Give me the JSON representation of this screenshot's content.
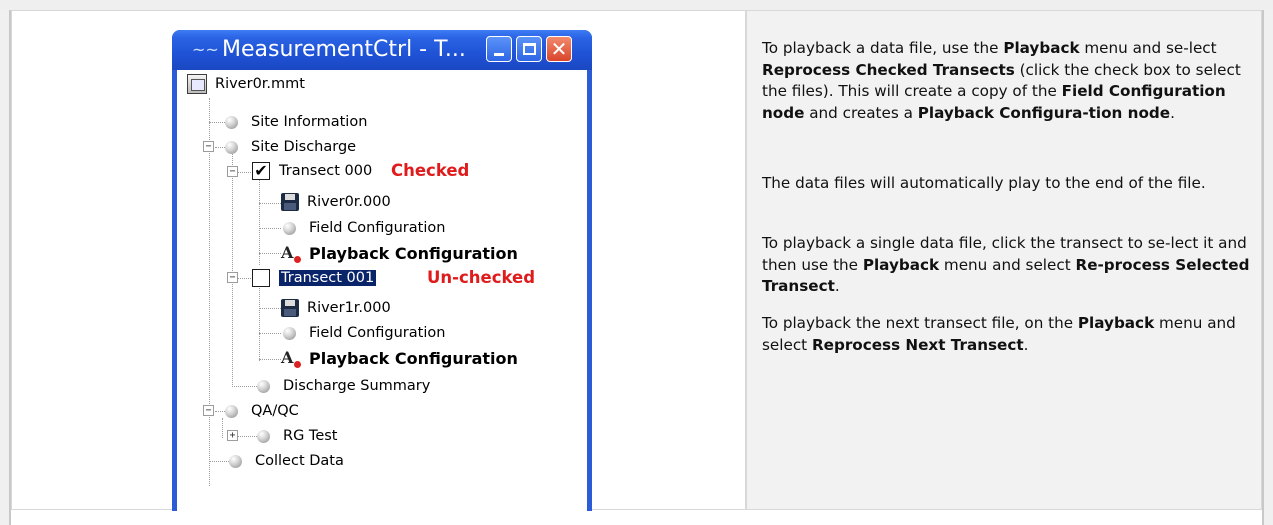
{
  "window": {
    "title": "MeasurementCtrl - T...",
    "title_icon": "measurement-app-icon"
  },
  "tree": {
    "root": "River0r.mmt",
    "site_information": "Site Information",
    "site_discharge": "Site Discharge",
    "transect0": {
      "label": "Transect 000",
      "checked": true,
      "annotation": "Checked",
      "file": "River0r.000",
      "field_config": "Field Configuration",
      "playback_config": "Playback Configuration"
    },
    "transect1": {
      "label": "Transect 001",
      "checked": false,
      "annotation": "Un-checked",
      "file": "River1r.000",
      "field_config": "Field Configuration",
      "playback_config": "Playback Configuration"
    },
    "discharge_summary": "Discharge Summary",
    "qaqc": "QA/QC",
    "rg_test": "RG Test",
    "collect_data": "Collect Data"
  },
  "colors": {
    "annotation": "#e01b1b",
    "selection": "#0a246a",
    "titlebar": "#2a63e4"
  },
  "instructions": {
    "p1": {
      "t1": "To playback a data file, use the ",
      "b1": "Playback",
      "t2": " menu and se-lect ",
      "b2": "Reprocess Checked Transects",
      "t3": " (click the check box to select the files). This will create a copy of the ",
      "b3": "Field Configuration node",
      "t4": " and creates a ",
      "b4": "Playback Configura-tion node",
      "t5": "."
    },
    "p2": "The data files will automatically play to the end of the file.",
    "p3": {
      "t1": "To playback a single data file, click the transect to se-lect it and then use the ",
      "b1": "Playback",
      "t2": " menu and select ",
      "b2": "Re-process Selected Transect",
      "t3": "."
    },
    "p4": {
      "t1": "To playback the next transect file, on the ",
      "b1": "Playback",
      "t2": " menu and select ",
      "b2": "Reprocess Next Transect",
      "t3": "."
    }
  }
}
